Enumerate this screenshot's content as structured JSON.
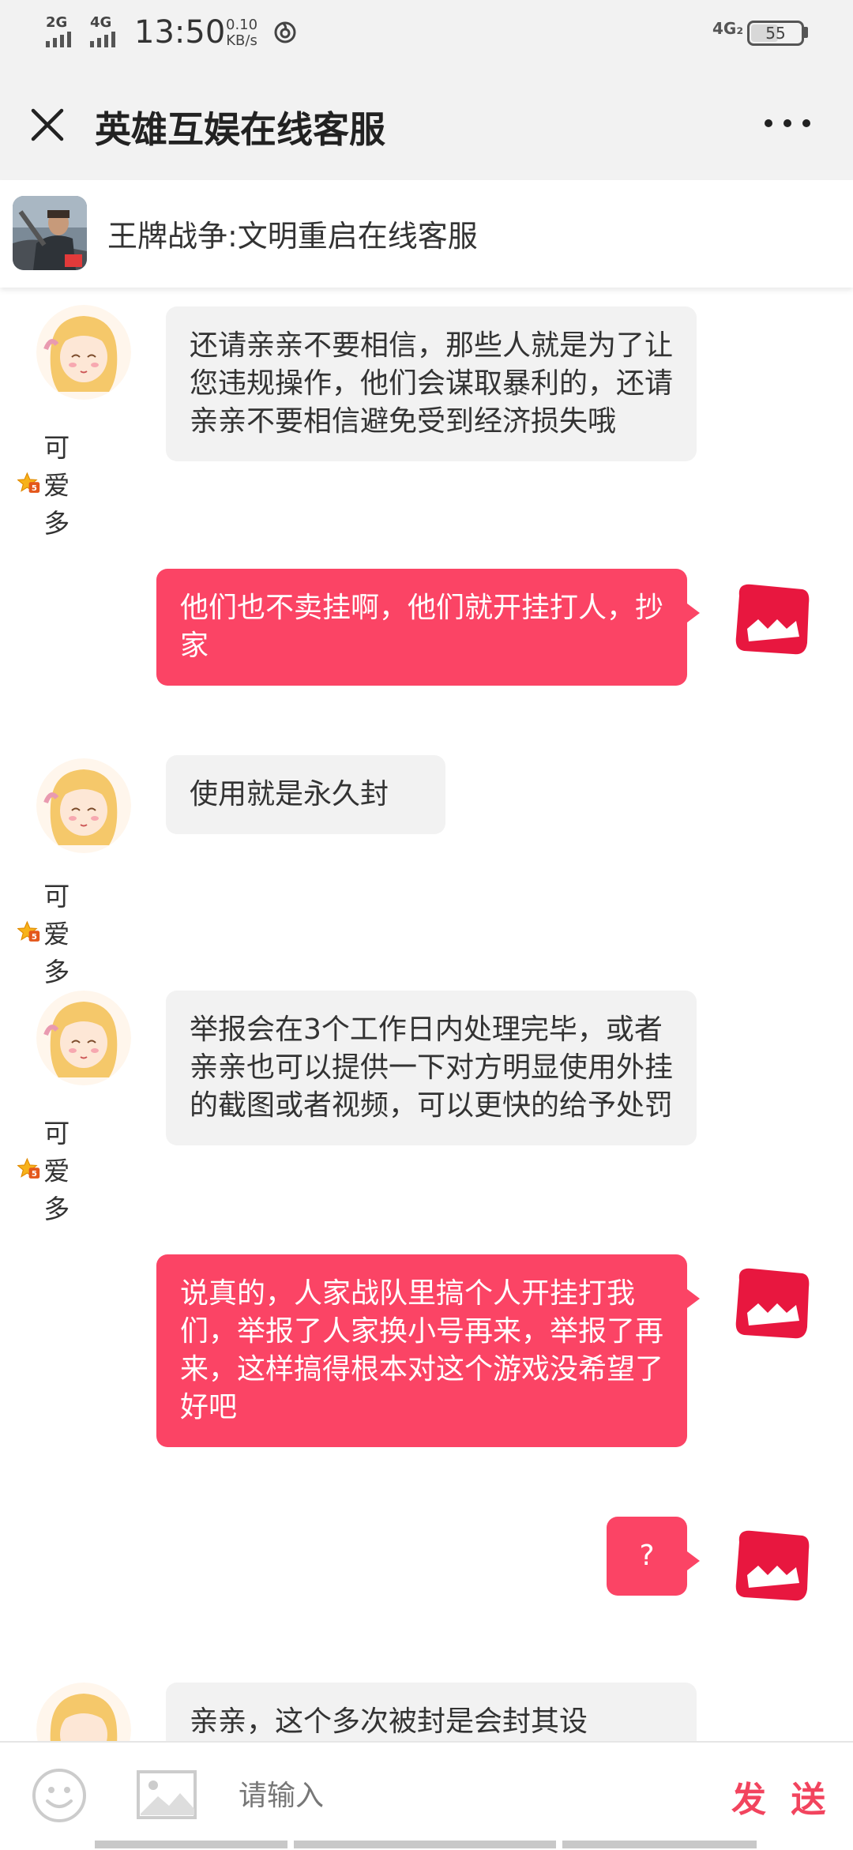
{
  "status_bar": {
    "net1": "2G",
    "net2": "4G",
    "time": "13:50",
    "speed_value": "0.10",
    "speed_unit": "KB/s",
    "network": "4G₂",
    "battery": "55",
    "battery_level": 0.55
  },
  "header": {
    "title": "英雄互娱在线客服",
    "close_icon": "close-icon",
    "more_icon": "more-icon"
  },
  "subheader": {
    "title": "王牌战争:文明重启在线客服"
  },
  "agent": {
    "name": "可爱多"
  },
  "messages": [
    {
      "from": "agent",
      "text": "还请亲亲不要相信，那些人就是为了让您违规操作，他们会谋取暴利的，还请亲亲不要相信避免受到经济损失哦"
    },
    {
      "from": "user",
      "text": "他们也不卖挂啊，他们就开挂打人，抄家"
    },
    {
      "from": "agent",
      "text": "使用就是永久封"
    },
    {
      "from": "agent",
      "text": "举报会在3个工作日内处理完毕，或者亲亲也可以提供一下对方明显使用外挂的截图或者视频，可以更快的给予处罚"
    },
    {
      "from": "user",
      "text": "说真的，人家战队里搞个人开挂打我们，举报了人家换小号再来，举报了再来，这样搞得根本对这个游戏没希望了好吧"
    },
    {
      "from": "user",
      "text": "?"
    },
    {
      "from": "agent",
      "text": "亲亲，这个多次被封是会封其设"
    }
  ],
  "input_bar": {
    "placeholder": "请输入",
    "send_label": "发 送"
  },
  "colors": {
    "accent": "#fb4465",
    "send": "#f2445e",
    "bubble_in": "#f2f2f2",
    "header_bg": "#f2f2f2"
  }
}
